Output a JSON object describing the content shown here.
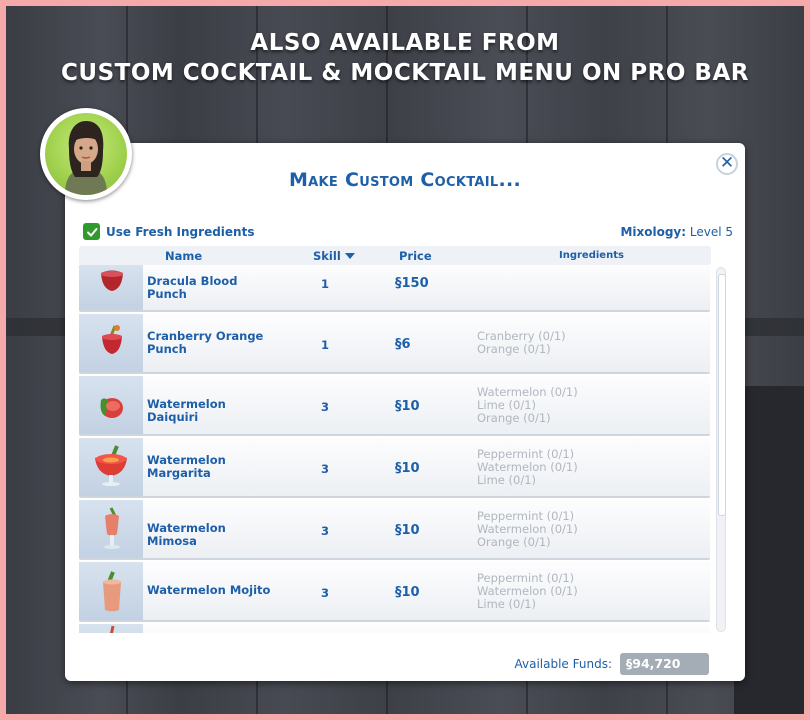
{
  "banner": {
    "line1": "ALSO AVAILABLE FROM",
    "line2": "CUSTOM COCKTAIL & MOCKTAIL MENU ON PRO BAR"
  },
  "dialog": {
    "title": "Make Custom Cocktail...",
    "close_icon": "close-icon",
    "fresh_label": "Use Fresh Ingredients",
    "fresh_checked": true,
    "skill_label": "Mixology:",
    "skill_value": "Level 5",
    "columns": {
      "name": "Name",
      "skill": "Skill",
      "price": "Price",
      "ingredients": "Ingredients"
    },
    "sort_icon": "sort-desc-icon",
    "currency_symbol": "§",
    "rows": [
      {
        "name": "Dracula Blood Punch",
        "skill": "1",
        "price": "150",
        "ingredients": []
      },
      {
        "name": "Cranberry Orange Punch",
        "skill": "1",
        "price": "6",
        "ingredients": [
          "Cranberry (0/1)",
          "Orange (0/1)"
        ]
      },
      {
        "name": "Watermelon Daiquiri",
        "skill": "3",
        "price": "10",
        "ingredients": [
          "Watermelon (0/1)",
          "Lime (0/1)",
          "Orange (0/1)"
        ]
      },
      {
        "name": "Watermelon Margarita",
        "skill": "3",
        "price": "10",
        "ingredients": [
          "Peppermint (0/1)",
          "Watermelon (0/1)",
          "Lime (0/1)"
        ]
      },
      {
        "name": "Watermelon Mimosa",
        "skill": "3",
        "price": "10",
        "ingredients": [
          "Peppermint (0/1)",
          "Watermelon (0/1)",
          "Orange (0/1)"
        ]
      },
      {
        "name": "Watermelon Mojito",
        "skill": "3",
        "price": "10",
        "ingredients": [
          "Peppermint (0/1)",
          "Watermelon (0/1)",
          "Lime (0/1)"
        ]
      }
    ],
    "funds_label": "Available Funds:",
    "funds_value": "§94,720"
  },
  "colors": {
    "accent": "#1d5fa8",
    "check": "#2f9b2d",
    "border": "#f4a9ab",
    "muted": "#b0b7c0"
  }
}
